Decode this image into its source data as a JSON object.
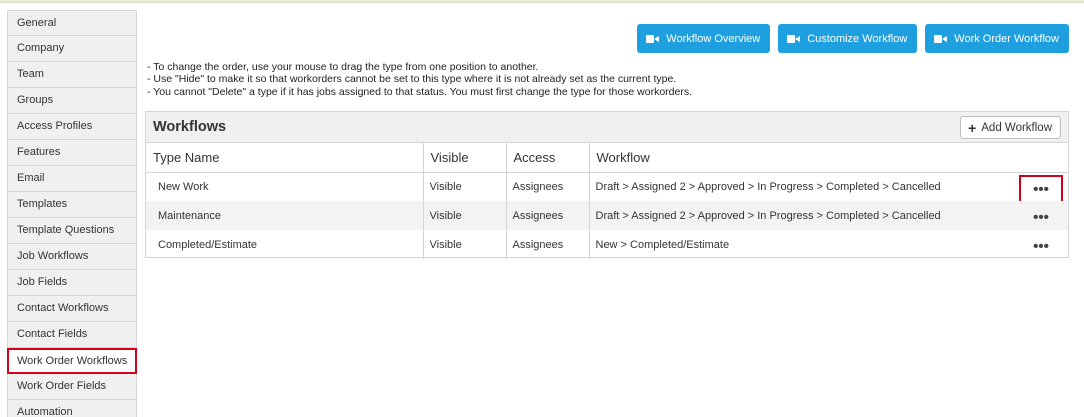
{
  "sidebar": {
    "items": [
      {
        "label": "General"
      },
      {
        "label": "Company"
      },
      {
        "label": "Team"
      },
      {
        "label": "Groups"
      },
      {
        "label": "Access Profiles"
      },
      {
        "label": "Features"
      },
      {
        "label": "Email"
      },
      {
        "label": "Templates"
      },
      {
        "label": "Template Questions"
      },
      {
        "label": "Job Workflows"
      },
      {
        "label": "Job Fields"
      },
      {
        "label": "Contact Workflows"
      },
      {
        "label": "Contact Fields"
      },
      {
        "label": "Work Order Workflows",
        "active": true
      },
      {
        "label": "Work Order Fields"
      },
      {
        "label": "Automation"
      }
    ]
  },
  "toolbar": {
    "workflow_overview": "Workflow Overview",
    "customize_workflow": "Customize Workflow",
    "work_order_workflow": "Work Order Workflow"
  },
  "notes": {
    "line1": "- To change the order, use your mouse to drag the type from one position to another.",
    "line2": "- Use \"Hide\" to make it so that workorders cannot be set to this type where it is not already set as the current type.",
    "line3": "- You cannot \"Delete\" a type if it has jobs assigned to that status. You must first change the type for those workorders."
  },
  "panel": {
    "title": "Workflows",
    "add_label": "Add Workflow",
    "columns": {
      "type_name": "Type Name",
      "visible": "Visible",
      "access": "Access",
      "workflow": "Workflow"
    },
    "rows": [
      {
        "type_name": "New Work",
        "visible": "Visible",
        "access": "Assignees",
        "workflow": "Draft > Assigned 2 > Approved > In Progress > Completed > Cancelled",
        "actions": "•••"
      },
      {
        "type_name": "Maintenance",
        "visible": "Visible",
        "access": "Assignees",
        "workflow": "Draft > Assigned 2 > Approved > In Progress > Completed > Cancelled",
        "actions": "•••"
      },
      {
        "type_name": "Completed/Estimate",
        "visible": "Visible",
        "access": "Assignees",
        "workflow": "New > Completed/Estimate",
        "actions": "•••"
      }
    ]
  },
  "colors": {
    "accent": "#1e9fe0",
    "highlight": "#d0021b",
    "header_bg": "#f0f0f0"
  }
}
